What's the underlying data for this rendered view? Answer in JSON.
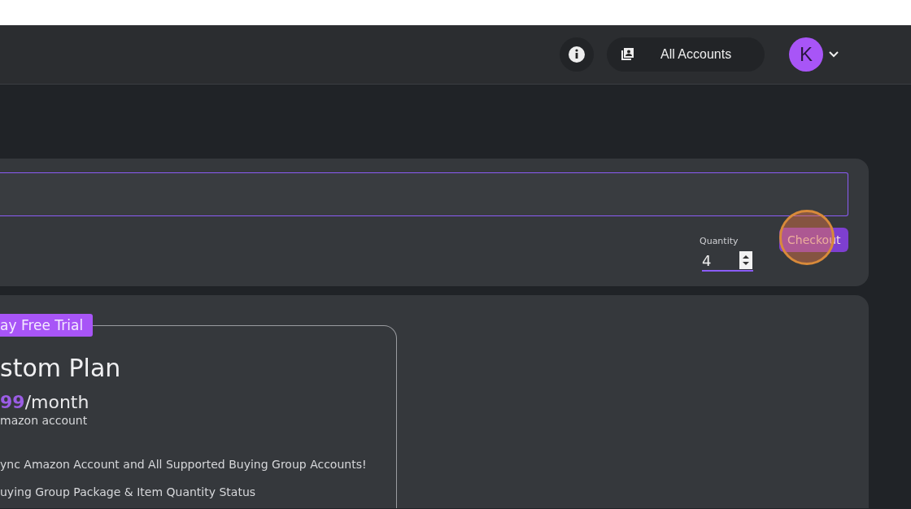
{
  "header": {
    "accounts_button": "All Accounts",
    "avatar_letter": "K"
  },
  "checkout": {
    "quantity_label": "Quantity",
    "quantity_value": "4",
    "button": "Checkout",
    "click_highlight": true
  },
  "plan": {
    "badge": "ay Free Trial",
    "title": "stom Plan",
    "price_amount": "99",
    "price_period": "/month",
    "price_note": "mazon account",
    "features": [
      "ync Amazon Account and All Supported Buying Group Accounts!",
      "uying Group Package & Item Quantity Status"
    ]
  }
}
